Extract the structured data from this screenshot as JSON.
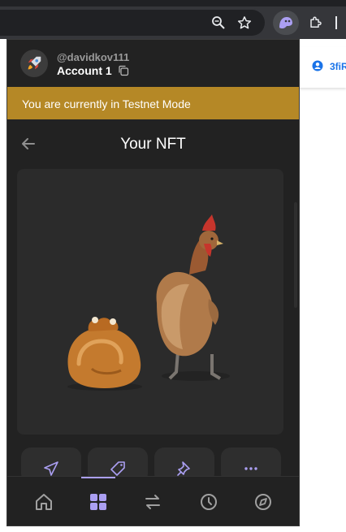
{
  "browser": {
    "icons": [
      "zoom-icon",
      "star-icon",
      "phantom-extension-icon",
      "puzzle-extensions-icon"
    ]
  },
  "background_page": {
    "snippet": "3fiR"
  },
  "account": {
    "username": "@davidkov111",
    "name": "Account 1",
    "avatar_icon": "rocket-icon"
  },
  "banner": {
    "text": "You are currently in Testnet Mode",
    "color": "#b58826"
  },
  "nft_view": {
    "title": "Your NFT",
    "image_subject": "two chickens (roasted and live)"
  },
  "actions": [
    {
      "icon": "send-icon"
    },
    {
      "icon": "tag-icon"
    },
    {
      "icon": "pin-icon"
    },
    {
      "icon": "more-icon"
    }
  ],
  "nav": [
    {
      "icon": "home-icon"
    },
    {
      "icon": "collectibles-grid-icon",
      "active": true
    },
    {
      "icon": "swap-icon"
    },
    {
      "icon": "history-icon"
    },
    {
      "icon": "explore-compass-icon"
    }
  ],
  "colors": {
    "accent": "#ab9ff2",
    "popup_bg": "#222222",
    "card_bg": "#2b2b2b"
  }
}
